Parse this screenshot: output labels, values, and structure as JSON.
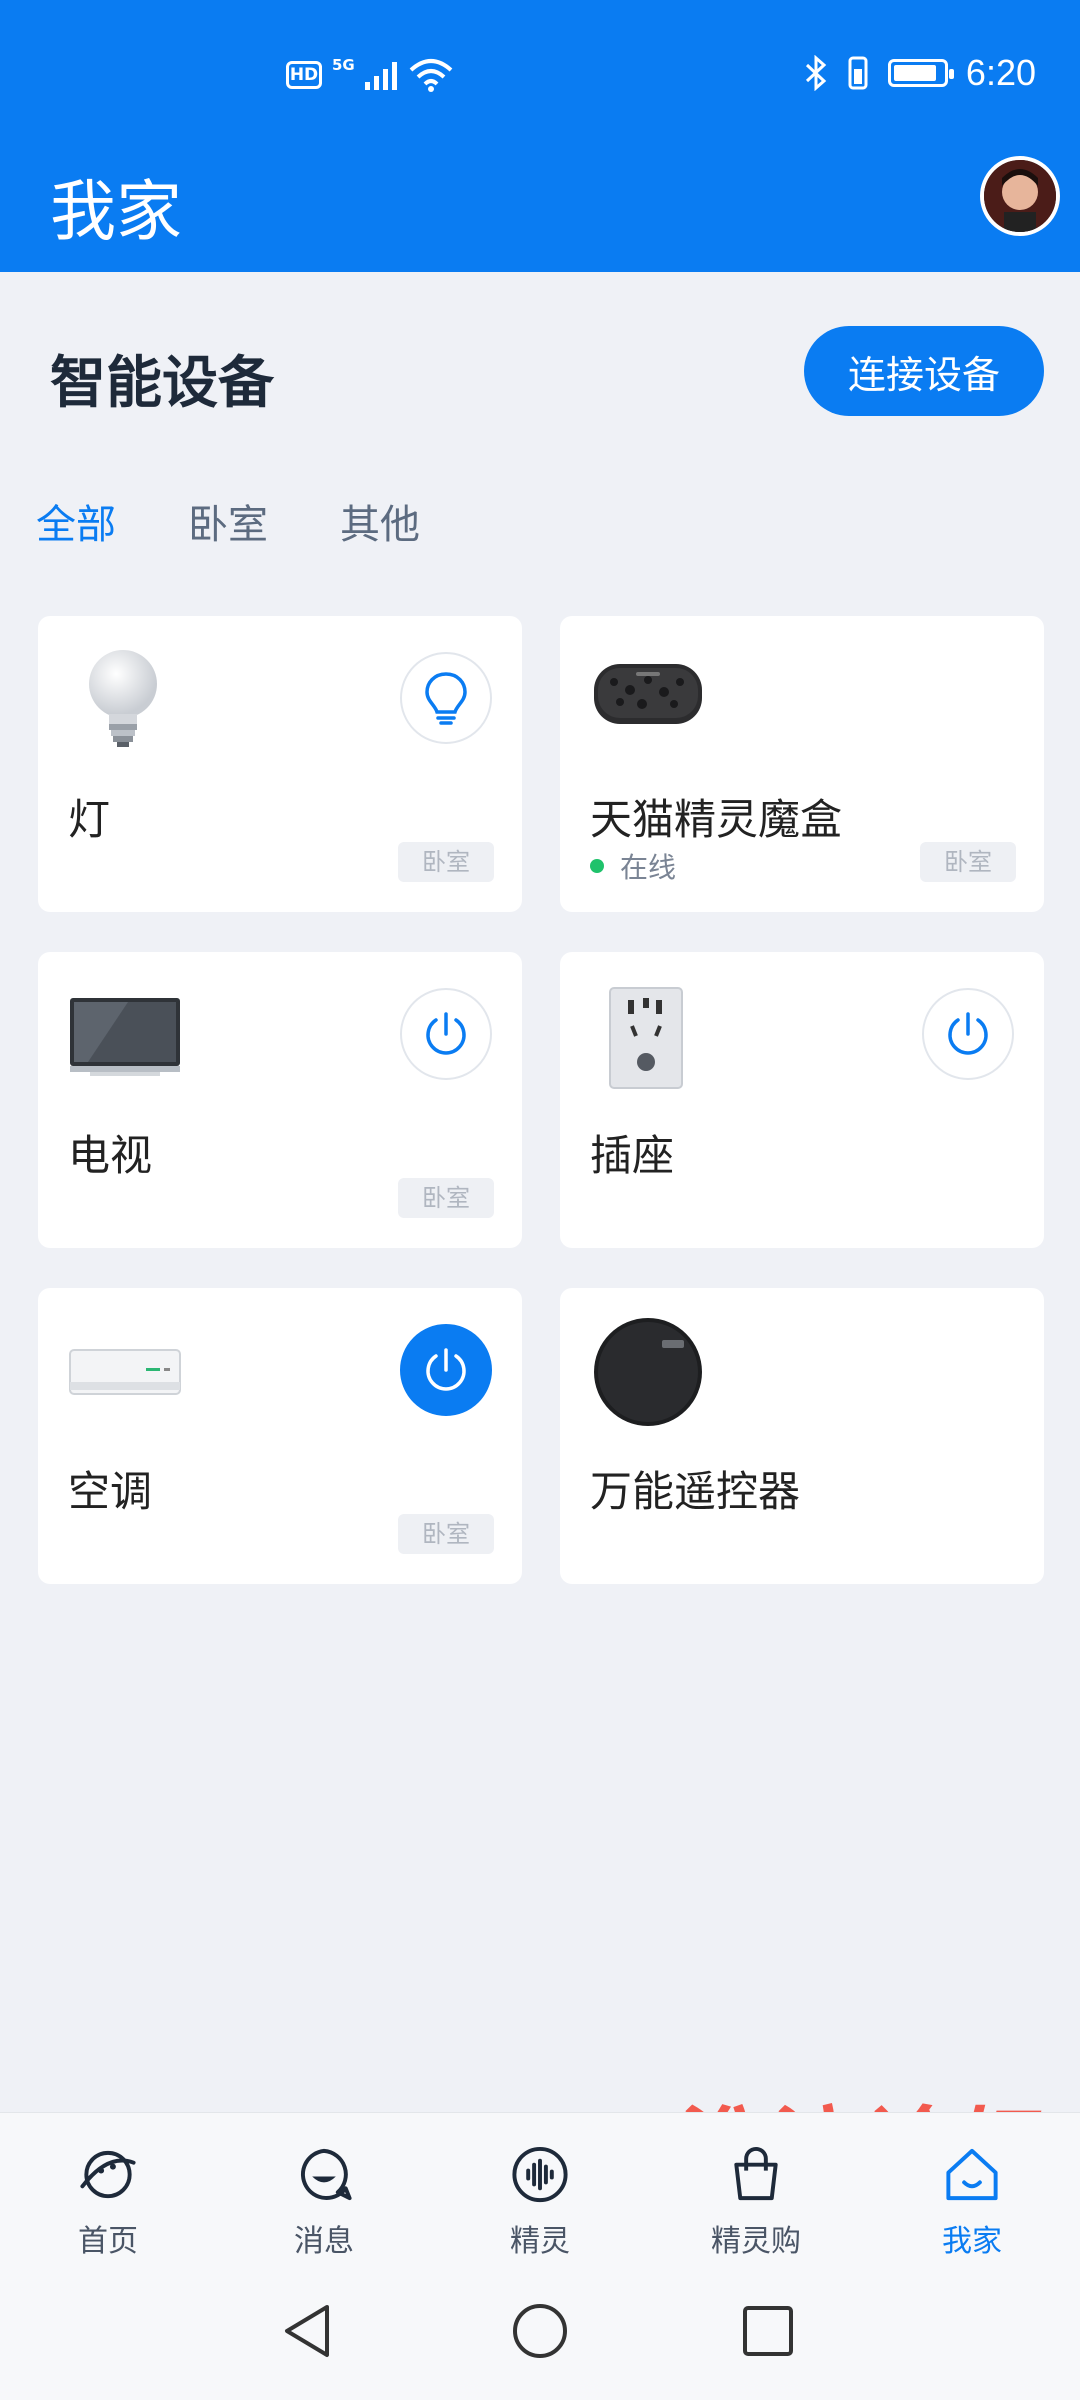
{
  "status_bar": {
    "hd": "HD",
    "network": "5G",
    "time": "6:20"
  },
  "header": {
    "title": "我家"
  },
  "section": {
    "title": "智能设备",
    "connect_button": "连接设备"
  },
  "tabs": [
    {
      "label": "全部",
      "active": true
    },
    {
      "label": "卧室",
      "active": false
    },
    {
      "label": "其他",
      "active": false
    }
  ],
  "devices": [
    {
      "name": "灯",
      "room": "卧室",
      "action": "lightbulb-icon"
    },
    {
      "name": "天猫精灵魔盒",
      "room": "卧室",
      "status": "在线"
    },
    {
      "name": "电视",
      "room": "卧室",
      "action": "power-icon"
    },
    {
      "name": "插座",
      "action": "power-icon"
    },
    {
      "name": "空调",
      "room": "卧室",
      "action": "power-icon",
      "power_on": true
    },
    {
      "name": "万能遥控器"
    }
  ],
  "bottom_nav": [
    {
      "label": "首页",
      "icon": "planet-icon"
    },
    {
      "label": "消息",
      "icon": "chat-icon"
    },
    {
      "label": "精灵",
      "icon": "voice-icon"
    },
    {
      "label": "精灵购",
      "icon": "bag-icon"
    },
    {
      "label": "我家",
      "icon": "home-icon",
      "active": true
    }
  ],
  "watermark": "淮滨论坛",
  "colors": {
    "primary": "#0a7cf2",
    "background": "#eff1f6",
    "online": "#1fc26b",
    "watermark": "#f25a4e"
  }
}
